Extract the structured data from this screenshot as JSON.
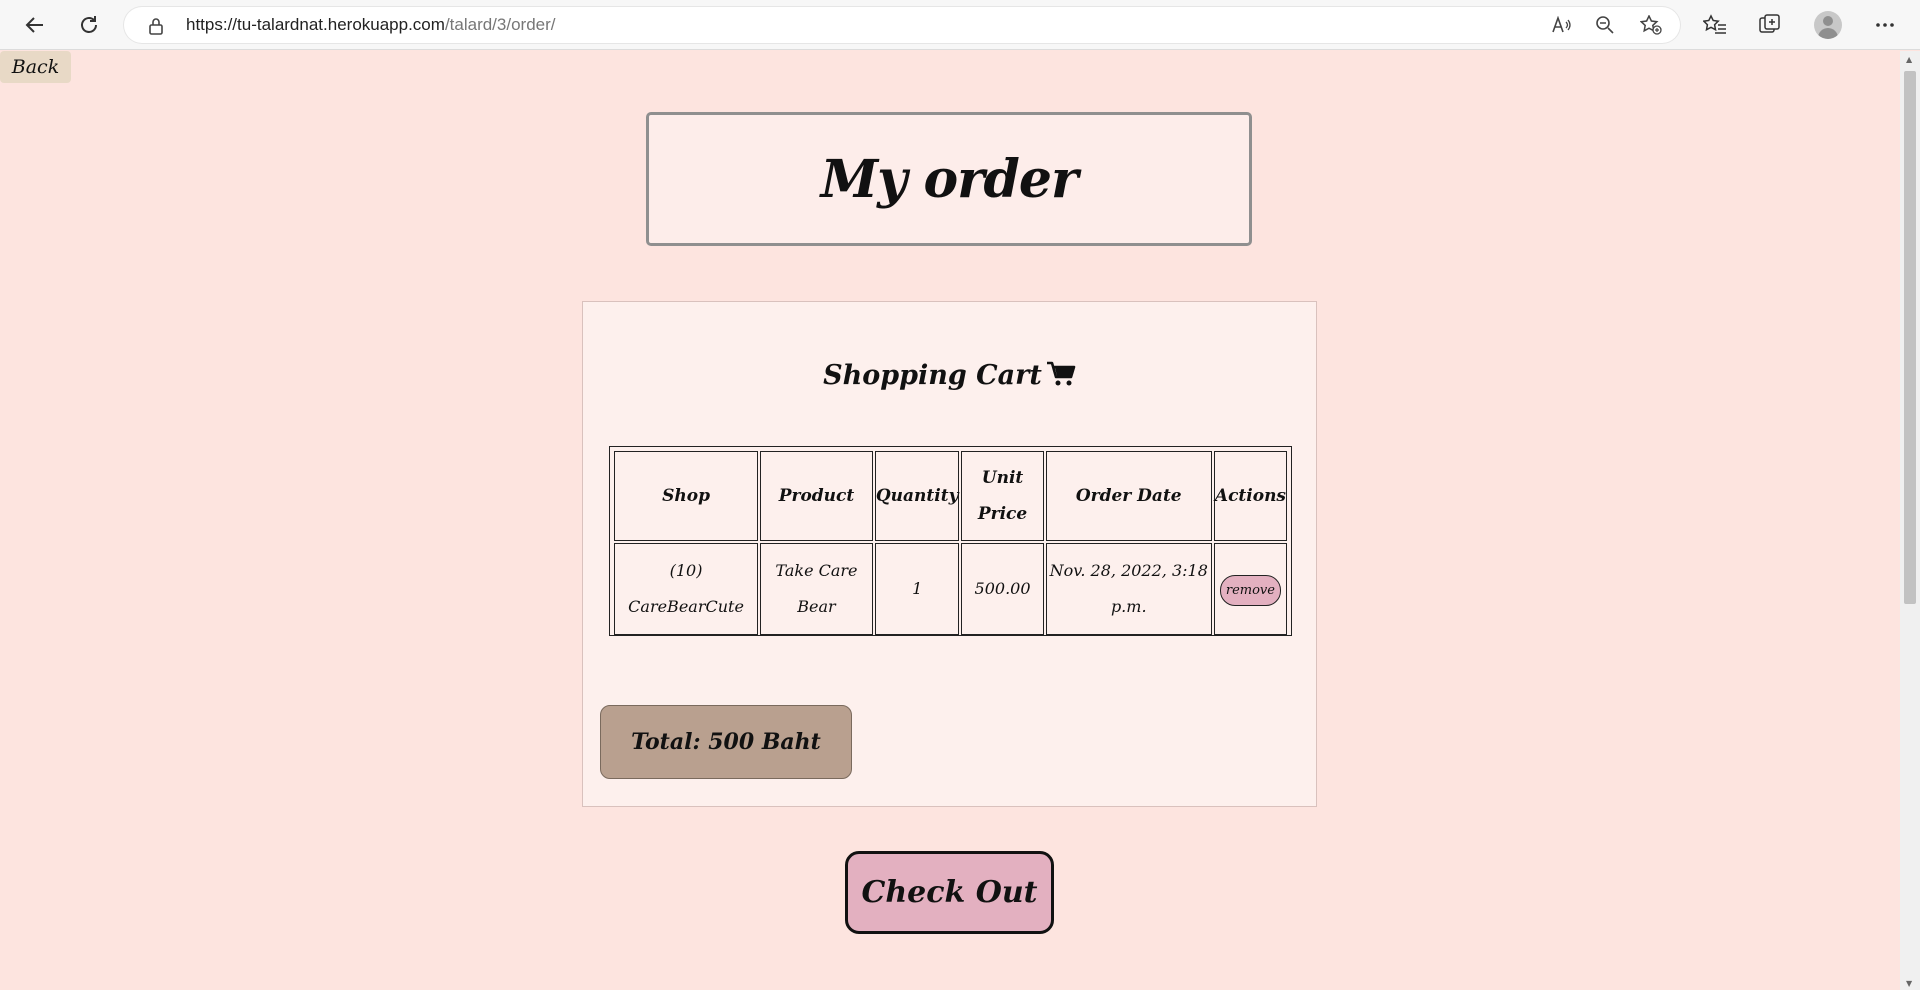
{
  "browser": {
    "url_host": "https://tu-talardnat.herokuapp.com",
    "url_path": "/talard/3/order/",
    "icons": [
      "back-arrow-icon",
      "refresh-icon",
      "lock-icon",
      "read-aloud-icon",
      "zoom-out-icon",
      "add-favorite-icon",
      "favorites-icon",
      "collections-icon",
      "profile-avatar",
      "more-menu-icon"
    ]
  },
  "page": {
    "back_label": "Back",
    "title": "My order",
    "cart": {
      "heading": "Shopping Cart",
      "icon": "cart-icon",
      "columns": [
        "Shop",
        "Product",
        "Quantity",
        "Unit Price",
        "Order Date",
        "Actions"
      ],
      "rows": [
        {
          "shop": "(10) CareBearCute",
          "product": "Take Care Bear",
          "quantity": "1",
          "unit_price": "500.00",
          "order_date": "Nov. 28, 2022, 3:18 p.m.",
          "action_label": "remove"
        }
      ],
      "total": "Total: 500 Baht"
    },
    "checkout_label": "Check Out"
  },
  "colors": {
    "page_bg": "#fde4df",
    "panel_bg": "#fdf0ed",
    "back_button": "#e8d9c6",
    "total_box": "#b9a08f",
    "pink_button": "#e3b0c0"
  }
}
